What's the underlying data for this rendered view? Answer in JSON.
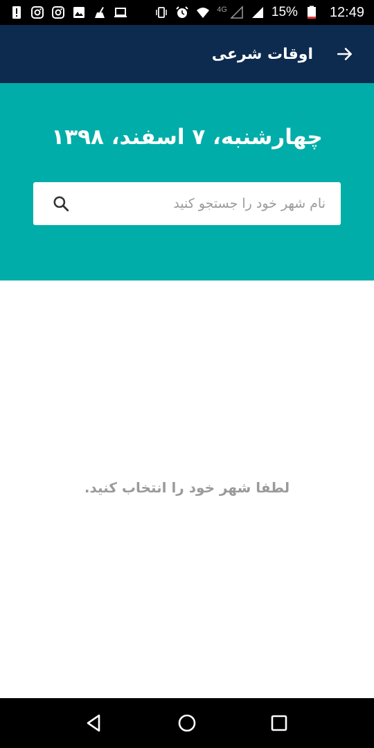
{
  "status_bar": {
    "icons_left": [
      "alert-icon",
      "instagram-icon",
      "instagram-icon",
      "image-icon",
      "cleaner-icon",
      "laptop-icon"
    ],
    "icons_right": [
      "vibrate-icon",
      "alarm-icon",
      "wifi-icon",
      "signal-icon",
      "signal-icon",
      "battery-icon"
    ],
    "network_label": "4G",
    "battery_percent": "15%",
    "time": "12:49"
  },
  "app_bar": {
    "title": "اوقات شرعی",
    "back_icon": "arrow-right-icon",
    "background": "#0d2a4f"
  },
  "header": {
    "date": "چهارشنبه، ۷ اسفند، ۱۳۹۸",
    "background": "#00ada9"
  },
  "search": {
    "placeholder": "نام شهر خود را جستجو کنید",
    "value": "",
    "icon": "search-icon"
  },
  "main": {
    "empty_message": "لطفا شهر خود را انتخاب کنید."
  },
  "nav_bar": {
    "buttons": [
      "back-triangle-icon",
      "home-circle-icon",
      "recents-square-icon"
    ]
  }
}
